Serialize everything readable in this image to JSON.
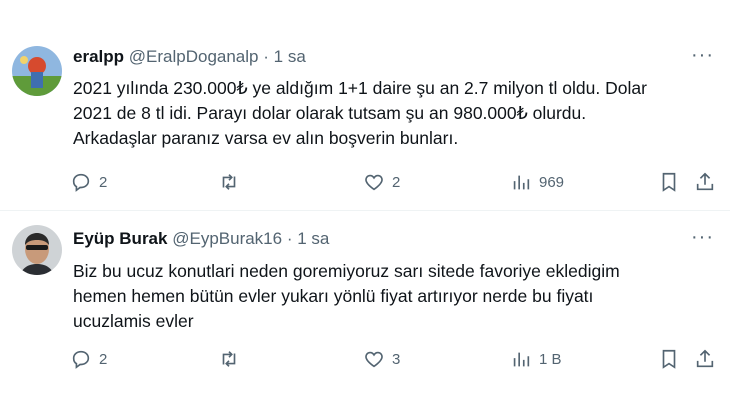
{
  "tweets": [
    {
      "name": "eralpp",
      "handle": "@EralpDoganalp",
      "dot": "·",
      "time": "1 sa",
      "more": "···",
      "lines": [
        "2021 yılında 230.000₺ ye aldığım 1+1 daire şu an 2.7 milyon tl oldu. Dolar",
        "2021 de 8 tl idi. Parayı dolar olarak tutsam şu an 980.000₺ olurdu.",
        "Arkadaşlar paranız varsa ev alın boşverin bunları."
      ],
      "replies": "2",
      "retweets": "",
      "likes": "2",
      "views": "969"
    },
    {
      "name": "Eyüp Burak",
      "handle": "@EypBurak16",
      "dot": "·",
      "time": "1 sa",
      "more": "···",
      "lines": [
        "Biz bu ucuz konutlari neden goremiyoruz sarı sitede favoriye ekledigim",
        "hemen hemen bütün evler yukarı yönlü fiyat artırıyor nerde bu fiyatı",
        "ucuzlamis evler"
      ],
      "replies": "2",
      "retweets": "",
      "likes": "3",
      "views": "1 B"
    }
  ],
  "colors": {
    "text": "#0f1419",
    "secondary": "#536471",
    "divider": "#eff3f4"
  },
  "icons": [
    "reply-icon",
    "retweet-icon",
    "like-icon",
    "views-icon",
    "bookmark-icon",
    "share-icon"
  ]
}
